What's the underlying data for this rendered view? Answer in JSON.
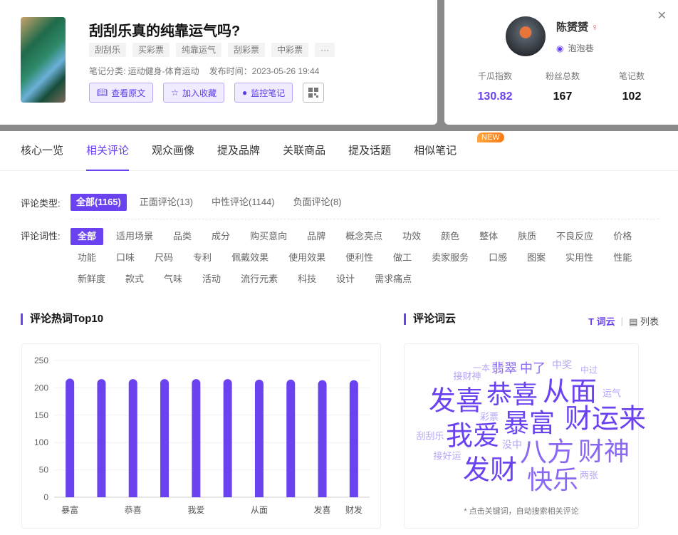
{
  "note": {
    "title": "刮刮乐真的纯靠运气吗?",
    "tags": [
      "刮刮乐",
      "买彩票",
      "纯靠运气",
      "刮彩票",
      "中彩票",
      "···"
    ],
    "category": "笔记分类: 运动健身-体育运动",
    "publish_time": "发布时间：2023-05-26 19:44",
    "buttons": {
      "view": "查看原文",
      "favorite": "加入收藏",
      "monitor": "监控笔记"
    }
  },
  "author": {
    "name": "陈赟赟",
    "gender": "♀",
    "level": "泡泡巷",
    "stats": [
      {
        "label": "千瓜指数",
        "value": "130.82"
      },
      {
        "label": "粉丝总数",
        "value": "167"
      },
      {
        "label": "笔记数",
        "value": "102"
      }
    ]
  },
  "tabs": [
    "核心一览",
    "相关评论",
    "观众画像",
    "提及品牌",
    "关联商品",
    "提及话题",
    "相似笔记"
  ],
  "new_badge": "NEW",
  "filters": {
    "type_label": "评论类型:",
    "types": [
      "全部(1165)",
      "正面评论(13)",
      "中性评论(1144)",
      "负面评论(8)"
    ],
    "word_label": "评论词性:",
    "words": [
      "全部",
      "适用场景",
      "品类",
      "成分",
      "购买意向",
      "品牌",
      "概念亮点",
      "功效",
      "颜色",
      "整体",
      "肤质",
      "不良反应",
      "价格",
      "功能",
      "口味",
      "尺码",
      "专利",
      "佩戴效果",
      "使用效果",
      "便利性",
      "做工",
      "卖家服务",
      "口感",
      "图案",
      "实用性",
      "性能",
      "新鲜度",
      "款式",
      "气味",
      "活动",
      "流行元素",
      "科技",
      "设计",
      "需求痛点"
    ]
  },
  "sections": {
    "top10": "评论热词Top10",
    "cloud": "评论词云",
    "cloud_view": "词云",
    "list_view": "列表",
    "hint": "* 点击关键词，自动搜索相关评论"
  },
  "colors": {
    "accent": "#6a42f0"
  },
  "chart_data": {
    "type": "bar",
    "categories": [
      "暴富",
      "",
      "恭喜",
      "",
      "我爱",
      "",
      "从面",
      "",
      "发喜",
      "财发"
    ],
    "values": [
      217,
      216,
      216,
      216,
      216,
      216,
      215,
      215,
      214,
      214
    ],
    "ylim": [
      0,
      250
    ],
    "yticks": [
      0,
      50,
      100,
      150,
      200,
      250
    ],
    "grid": true,
    "xlabel": "",
    "ylabel": ""
  },
  "cloud": [
    "一本",
    "翡翠",
    "中了",
    "中奖",
    "中过",
    "接财神",
    "发喜",
    "恭喜",
    "从面",
    "运气",
    "彩票",
    "暴富",
    "财运来",
    "刮刮乐",
    "我爱",
    "没中",
    "八方",
    "财神",
    "接好运",
    "发财",
    "快乐",
    "两张"
  ]
}
